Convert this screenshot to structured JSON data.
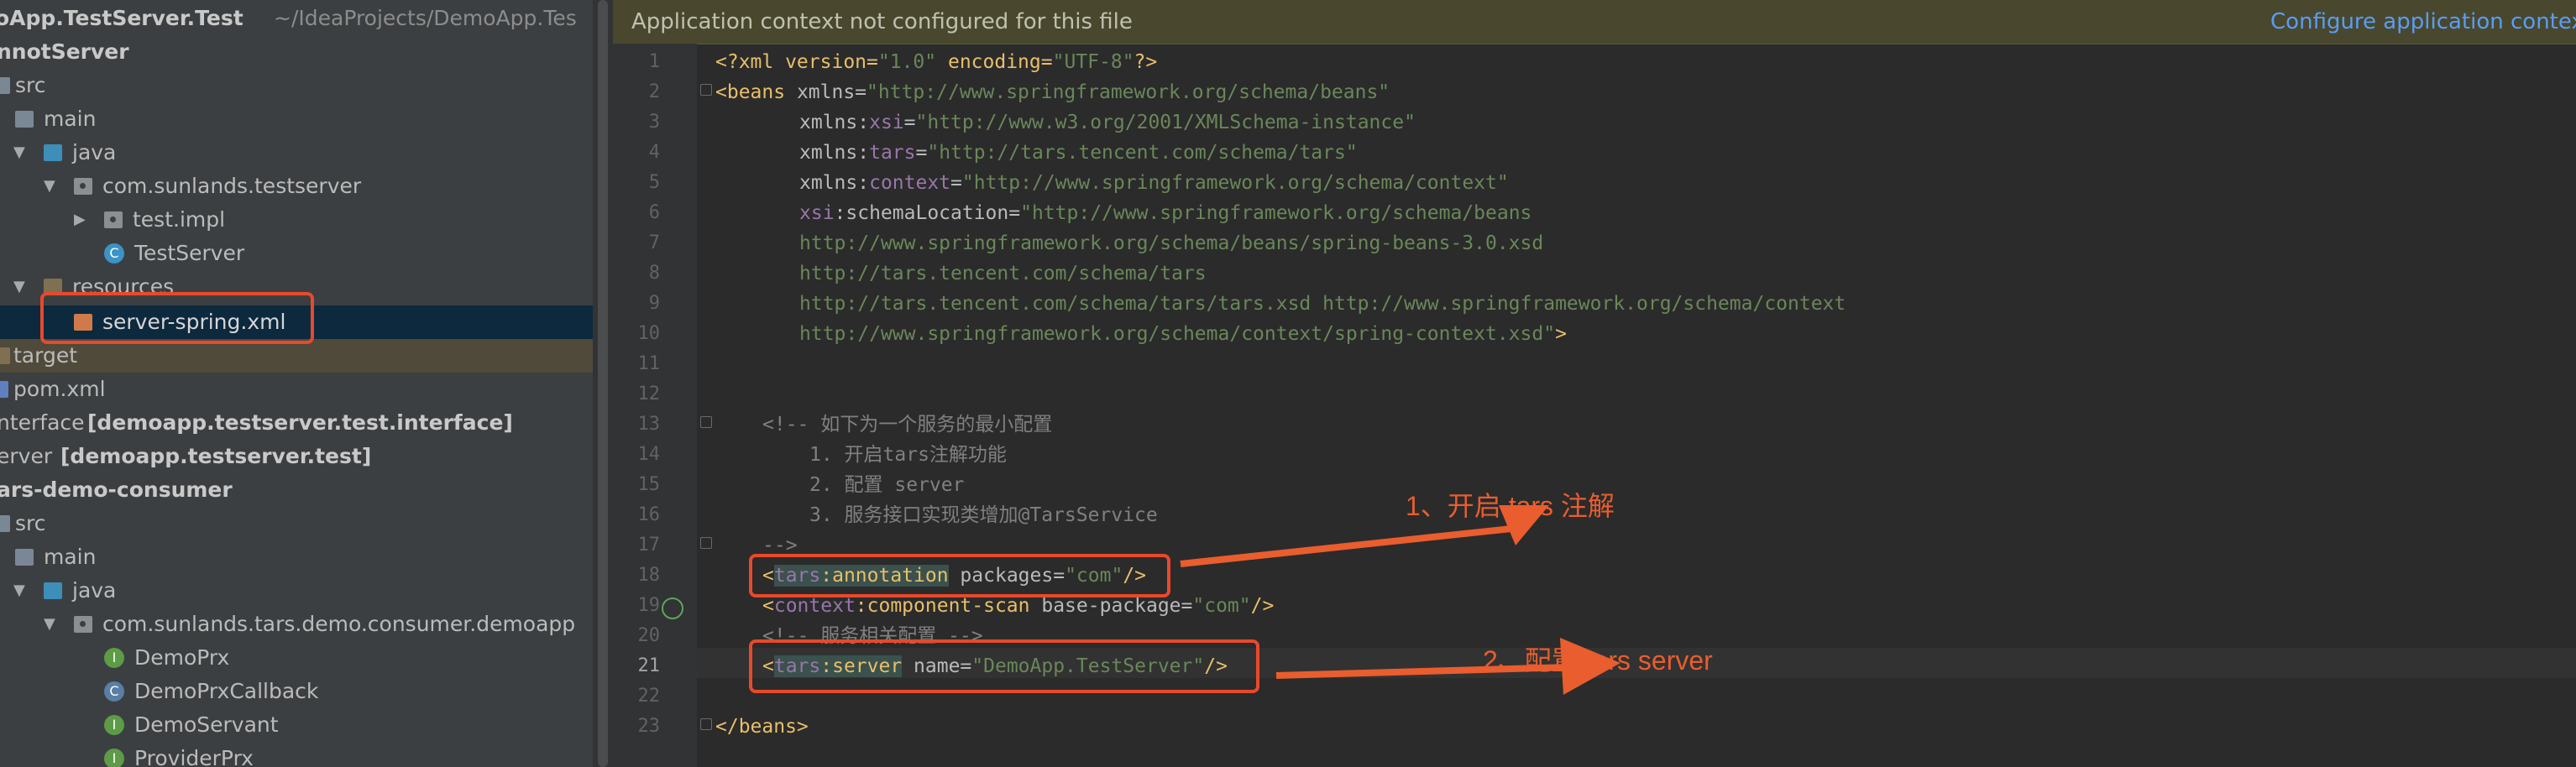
{
  "project_tree": {
    "rows": [
      {
        "label": "oApp.TestServer.Test",
        "suffix": "~/IdeaProjects/DemoApp.Tes"
      },
      {
        "label": "nnotServer"
      },
      {
        "label": "src"
      },
      {
        "label": "main"
      },
      {
        "label": "java"
      },
      {
        "label": "com.sunlands.testserver"
      },
      {
        "label": "test.impl"
      },
      {
        "label": "TestServer"
      },
      {
        "label": "resources"
      },
      {
        "label": "server-spring.xml"
      },
      {
        "label": "target"
      },
      {
        "label": "pom.xml"
      },
      {
        "label": "nterface",
        "suffix": "[demoapp.testserver.test.interface]"
      },
      {
        "label": "erver",
        "suffix": "[demoapp.testserver.test]"
      },
      {
        "label": "ars-demo-consumer"
      },
      {
        "label": "src"
      },
      {
        "label": "main"
      },
      {
        "label": "java"
      },
      {
        "label": "com.sunlands.tars.demo.consumer.demoapp"
      },
      {
        "label": "DemoPrx"
      },
      {
        "label": "DemoPrxCallback"
      },
      {
        "label": "DemoServant"
      },
      {
        "label": "ProviderPrx"
      }
    ]
  },
  "banner": {
    "message": "Application context not configured for this file",
    "action": "Configure application context"
  },
  "editor": {
    "line_numbers": [
      "1",
      "2",
      "3",
      "4",
      "5",
      "6",
      "7",
      "8",
      "9",
      "10",
      "11",
      "12",
      "13",
      "14",
      "15",
      "16",
      "17",
      "18",
      "19",
      "20",
      "21",
      "22",
      "23"
    ],
    "lines": {
      "l1": {
        "a": "<?xml version=",
        "b": "\"1.0\"",
        "c": " encoding=",
        "d": "\"UTF-8\"",
        "e": "?>"
      },
      "l2": {
        "a": "<beans",
        "b": " xmlns=",
        "c": "\"http://www.springframework.org/schema/beans\""
      },
      "l3": {
        "a": "xmlns:",
        "b": "xsi",
        "c": "=",
        "d": "\"http://www.w3.org/2001/XMLSchema-instance\""
      },
      "l4": {
        "a": "xmlns:",
        "b": "tars",
        "c": "=",
        "d": "\"http://tars.tencent.com/schema/tars\""
      },
      "l5": {
        "a": "xmlns:",
        "b": "context",
        "c": "=",
        "d": "\"http://www.springframework.org/schema/context\""
      },
      "l6": {
        "a": "xsi",
        "b": ":schemaLocation=",
        "c": "\"http://www.springframework.org/schema/beans"
      },
      "l7": "http://www.springframework.org/schema/beans/spring-beans-3.0.xsd",
      "l8": "http://tars.tencent.com/schema/tars",
      "l9": "http://tars.tencent.com/schema/tars/tars.xsd http://www.springframework.org/schema/context",
      "l10": {
        "a": "http://www.springframework.org/schema/context/spring-context.xsd\"",
        "b": ">"
      },
      "l13": "<!-- 如下为一个服务的最小配置",
      "l14": "1. 开启tars注解功能",
      "l15": "2. 配置 server",
      "l16": "3. 服务接口实现类增加@TarsService",
      "l17": "-->",
      "l18": {
        "a": "<",
        "b": "tars",
        "c": ":annotation",
        "d": " packages=",
        "e": "\"com\"",
        "f": "/>"
      },
      "l19": {
        "a": "<",
        "b": "context",
        "c": ":component-scan",
        "d": " base-package=",
        "e": "\"com\"",
        "f": "/>"
      },
      "l20": "<!-- 服务相关配置 -->",
      "l21": {
        "a": "<",
        "b": "tars",
        "c": ":server",
        "d": " name=",
        "e": "\"DemoApp.TestServer\"",
        "f": "/>"
      },
      "l23": "</beans>"
    }
  },
  "annotations": {
    "note1": "1、开启 tars 注解",
    "note2": "2、配置 tars server"
  },
  "colors": {
    "annotation": "#e95d2e",
    "xml_tag": "#e8bf6a",
    "xml_value": "#6a8759",
    "namespace": "#9876aa",
    "comment": "#808080"
  }
}
